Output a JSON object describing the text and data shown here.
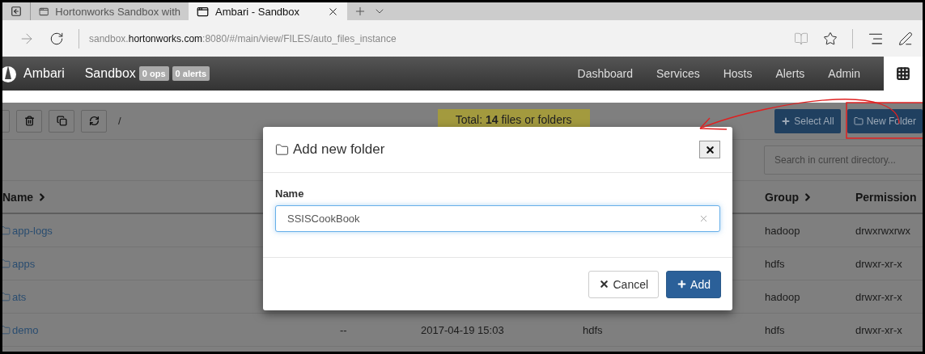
{
  "browser": {
    "tabs": [
      {
        "title": "Hortonworks Sandbox with",
        "selected": false
      },
      {
        "title": "Ambari - Sandbox",
        "selected": true
      }
    ],
    "address": "sandbox.**hortonworks.com**:8080/#/main/view/FILES/auto_files_instance"
  },
  "navbar": {
    "brand": "Ambari",
    "cluster": "Sandbox",
    "badges": [
      "0 ops",
      "0 alerts"
    ],
    "links": [
      "Dashboard",
      "Services",
      "Hosts",
      "Alerts",
      "Admin"
    ]
  },
  "toolbar": {
    "breadcrumb": "/",
    "total": "Total: **14** files or folders",
    "buttons": [
      {
        "kind": "select",
        "label": "Select All"
      },
      {
        "kind": "folder",
        "label": "New Folder"
      }
    ]
  },
  "search": {
    "placeholder": "Search in current directory..."
  },
  "table": {
    "columns": [
      {
        "label": "Name",
        "sortable": true
      },
      {
        "label": "Group",
        "sortable": true
      },
      {
        "label": "Permission",
        "sortable": false
      }
    ],
    "rows": [
      {
        "name": "app-logs",
        "group": "hadoop",
        "permission": "drwxrwxrwx"
      },
      {
        "name": "apps",
        "group": "hdfs",
        "permission": "drwxr-xr-x"
      },
      {
        "name": "ats",
        "group": "hadoop",
        "permission": "drwxr-xr-x"
      },
      {
        "name": "demo",
        "size": "--",
        "modified": "2017-04-19 15:03",
        "owner": "hdfs",
        "group": "hdfs",
        "permission": "drwxr-xr-x"
      }
    ]
  },
  "dialog": {
    "title": "Add new folder",
    "field_label": "Name",
    "value": "SSISCookBook",
    "buttons": [
      {
        "kind": "cancel",
        "label": "Cancel"
      },
      {
        "kind": "add",
        "label": "Add"
      }
    ]
  }
}
